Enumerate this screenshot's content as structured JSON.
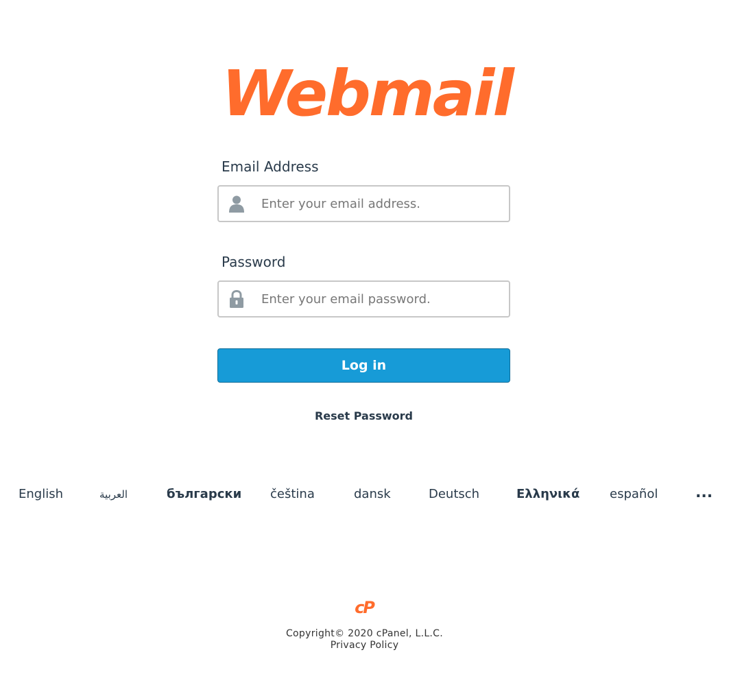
{
  "brand": {
    "logo_text": "Webmail",
    "logo_color": "#ff6c2c"
  },
  "form": {
    "email": {
      "label": "Email Address",
      "placeholder": "Enter your email address.",
      "value": "",
      "icon": "user-icon"
    },
    "password": {
      "label": "Password",
      "placeholder": "Enter your email password.",
      "value": "",
      "icon": "lock-icon"
    },
    "login_label": "Log in",
    "login_color": "#179bd7",
    "reset_label": "Reset Password"
  },
  "languages": {
    "items": [
      "English",
      "العربية",
      "български",
      "čeština",
      "dansk",
      "Deutsch",
      "Ελληνικά",
      "español"
    ],
    "more_label": "..."
  },
  "footer": {
    "cp_logo_text": "cP",
    "copyright": "Copyright© 2020 cPanel, L.L.C.",
    "privacy": "Privacy Policy"
  }
}
